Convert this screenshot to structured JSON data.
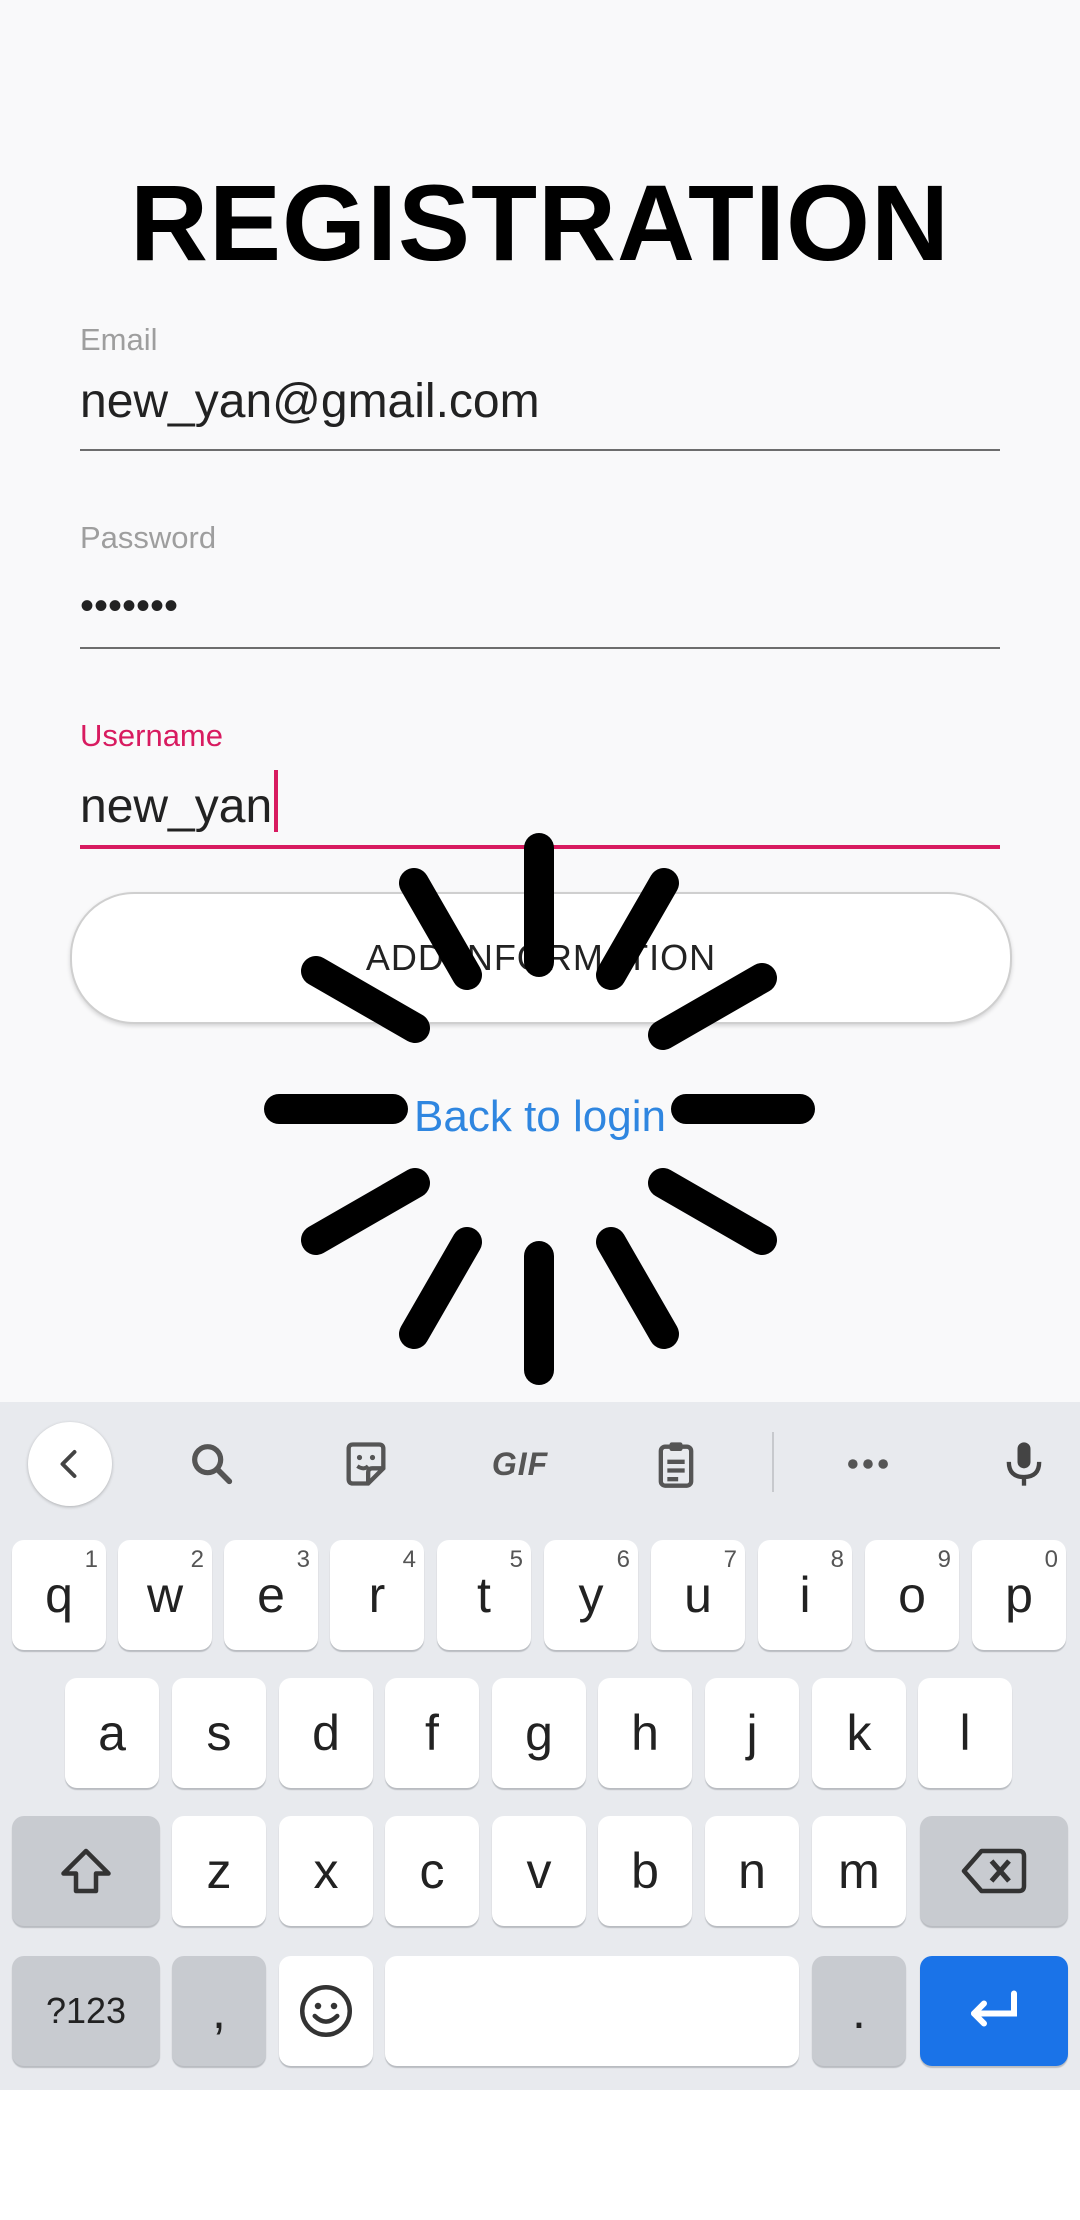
{
  "page": {
    "title": "REGISTRATION"
  },
  "form": {
    "email": {
      "label": "Email",
      "value": "new_yan@gmail.com"
    },
    "password": {
      "label": "Password",
      "value": "•••••••"
    },
    "username": {
      "label": "Username",
      "value": "new_yan"
    },
    "add_button": "ADD INFORMATION",
    "back_link": "Back to login"
  },
  "colors": {
    "accent": "#d81b60",
    "link": "#2f86e0",
    "enter_key": "#1a73e8"
  },
  "keyboard": {
    "toolbar": [
      "back-icon",
      "search-icon",
      "sticker-icon",
      "GIF",
      "clipboard-icon",
      "more-icon",
      "mic-icon"
    ],
    "gif_label": "GIF",
    "row1": [
      {
        "k": "q",
        "s": "1"
      },
      {
        "k": "w",
        "s": "2"
      },
      {
        "k": "e",
        "s": "3"
      },
      {
        "k": "r",
        "s": "4"
      },
      {
        "k": "t",
        "s": "5"
      },
      {
        "k": "y",
        "s": "6"
      },
      {
        "k": "u",
        "s": "7"
      },
      {
        "k": "i",
        "s": "8"
      },
      {
        "k": "o",
        "s": "9"
      },
      {
        "k": "p",
        "s": "0"
      }
    ],
    "row2": [
      "a",
      "s",
      "d",
      "f",
      "g",
      "h",
      "j",
      "k",
      "l"
    ],
    "row3": [
      "z",
      "x",
      "c",
      "v",
      "b",
      "n",
      "m"
    ],
    "row4": {
      "symbols": "?123",
      "comma": ",",
      "period": "."
    }
  }
}
